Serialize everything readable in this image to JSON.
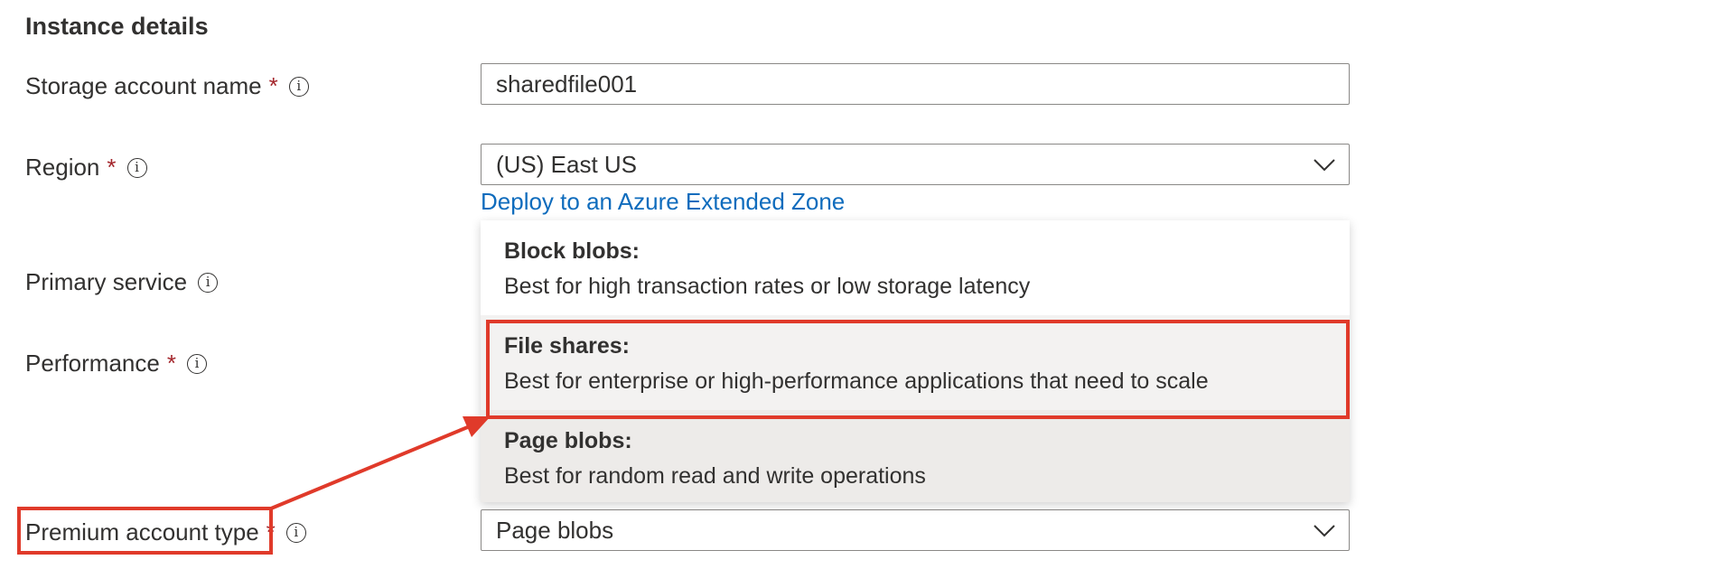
{
  "section": {
    "title": "Instance details"
  },
  "fields": {
    "storage_account_name": {
      "label": "Storage account name",
      "required_mark": "*",
      "value": "sharedfile001"
    },
    "region": {
      "label": "Region",
      "required_mark": "*",
      "value": "(US) East US",
      "extended_zone_link": "Deploy to an Azure Extended Zone"
    },
    "primary_service": {
      "label": "Primary service"
    },
    "performance": {
      "label": "Performance",
      "required_mark": "*"
    },
    "premium_account_type": {
      "label": "Premium account type",
      "required_mark": "*",
      "value": "Page blobs"
    }
  },
  "dropdown": {
    "options": [
      {
        "title": "Block blobs:",
        "description": "Best for high transaction rates or low storage latency"
      },
      {
        "title": "File shares:",
        "description": "Best for enterprise or high-performance applications that need to scale"
      },
      {
        "title": "Page blobs:",
        "description": "Best for random read and write operations"
      }
    ],
    "highlighted_index": 1,
    "selected_index": 2
  },
  "icons": {
    "info": "info-icon",
    "chevron": "chevron-down-icon"
  },
  "colors": {
    "annotation_red": "#e03a2a",
    "link_blue": "#0f6cbd",
    "required_red": "#a4262c",
    "option_hover_bg": "#f3f2f1",
    "option_selected_bg": "#edebe9"
  }
}
